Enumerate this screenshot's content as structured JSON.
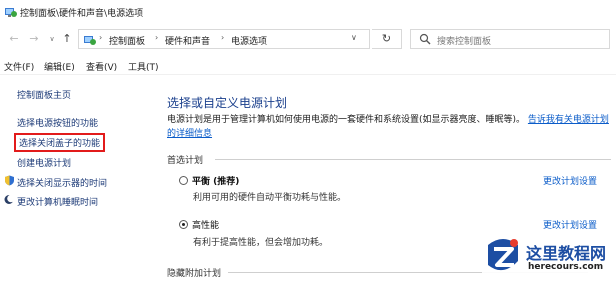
{
  "window": {
    "title": "控制面板\\硬件和声音\\电源选项",
    "icon": "control-panel-icon"
  },
  "nav": {
    "back_icon": "←",
    "forward_icon": "→",
    "up_icon": "↑",
    "breadcrumb": [
      "控制面板",
      "硬件和声音",
      "电源选项"
    ],
    "separator": "›",
    "dropdown_icon": "∨",
    "refresh_icon": "↻",
    "search_placeholder": "搜索控制面板"
  },
  "menubar": {
    "items": [
      "文件(F)",
      "编辑(E)",
      "查看(V)",
      "工具(T)"
    ]
  },
  "sidebar": {
    "items": [
      {
        "label": "控制面板主页"
      },
      {
        "label": "选择电源按钮的功能"
      },
      {
        "label": "选择关闭盖子的功能",
        "highlighted": true
      },
      {
        "label": "创建电源计划"
      },
      {
        "label": "选择关闭显示器的时间",
        "icon": "power-shield-icon"
      },
      {
        "label": "更改计算机睡眠时间",
        "icon": "moon-icon"
      }
    ]
  },
  "main": {
    "title": "选择或自定义电源计划",
    "description": "电源计划是用于管理计算机如何使用电源的一套硬件和系统设置(如显示器亮度、睡眠等)。",
    "description_link": "告诉我有关电源计划的详细信息",
    "preferred_label": "首选计划",
    "plans": [
      {
        "name": "平衡 (推荐)",
        "description": "利用可用的硬件自动平衡功耗与性能。",
        "link": "更改计划设置",
        "selected": false
      },
      {
        "name": "高性能",
        "description": "有利于提高性能，但会增加功耗。",
        "link": "更改计划设置",
        "selected": true
      }
    ],
    "hidden_label": "隐藏附加计划"
  },
  "watermark": {
    "chinese": "这里教程网",
    "url": "herecours.com"
  },
  "colors": {
    "link": "#1c3a77",
    "title_blue": "#1a3f8c",
    "highlight_border": "#e21b1b"
  }
}
